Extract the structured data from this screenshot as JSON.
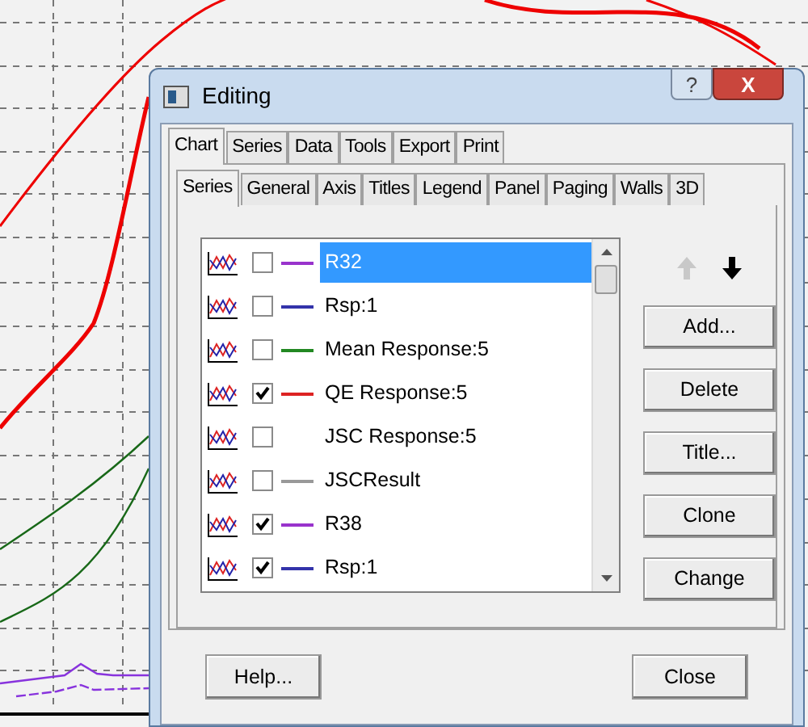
{
  "window": {
    "title": "Editing"
  },
  "title_buttons": [
    {
      "kind": "help",
      "label": "?"
    },
    {
      "kind": "close",
      "label": "X"
    }
  ],
  "tabs": [
    {
      "label": "Chart",
      "selected": true
    },
    {
      "label": "Series",
      "selected": false
    },
    {
      "label": "Data",
      "selected": false
    },
    {
      "label": "Tools",
      "selected": false
    },
    {
      "label": "Export",
      "selected": false
    },
    {
      "label": "Print",
      "selected": false
    }
  ],
  "subtabs": [
    {
      "label": "Series",
      "selected": true
    },
    {
      "label": "General",
      "selected": false
    },
    {
      "label": "Axis",
      "selected": false
    },
    {
      "label": "Titles",
      "selected": false
    },
    {
      "label": "Legend",
      "selected": false
    },
    {
      "label": "Panel",
      "selected": false
    },
    {
      "label": "Paging",
      "selected": false
    },
    {
      "label": "Walls",
      "selected": false
    },
    {
      "label": "3D",
      "selected": false
    }
  ],
  "series": [
    {
      "name": "R32",
      "checked": false,
      "color": "#9933cc",
      "selected": true
    },
    {
      "name": "Rsp:1",
      "checked": false,
      "color": "#3333aa",
      "selected": false
    },
    {
      "name": "Mean Response:5",
      "checked": false,
      "color": "#228822",
      "selected": false
    },
    {
      "name": "QE Response:5",
      "checked": true,
      "color": "#dd2222",
      "selected": false
    },
    {
      "name": "JSC Response:5",
      "checked": false,
      "selected": false
    },
    {
      "name": "JSCResult",
      "checked": false,
      "color": "#999999",
      "selected": false
    },
    {
      "name": "R38",
      "checked": true,
      "color": "#9933cc",
      "selected": false
    },
    {
      "name": "Rsp:1",
      "checked": true,
      "color": "#3333aa",
      "selected": false
    }
  ],
  "move_up": {
    "disabled": true
  },
  "move_down": {
    "disabled": false
  },
  "side_buttons": [
    "Add...",
    "Delete",
    "Title...",
    "Clone",
    "Change"
  ],
  "footer_buttons": [
    "Help...",
    "Close"
  ]
}
